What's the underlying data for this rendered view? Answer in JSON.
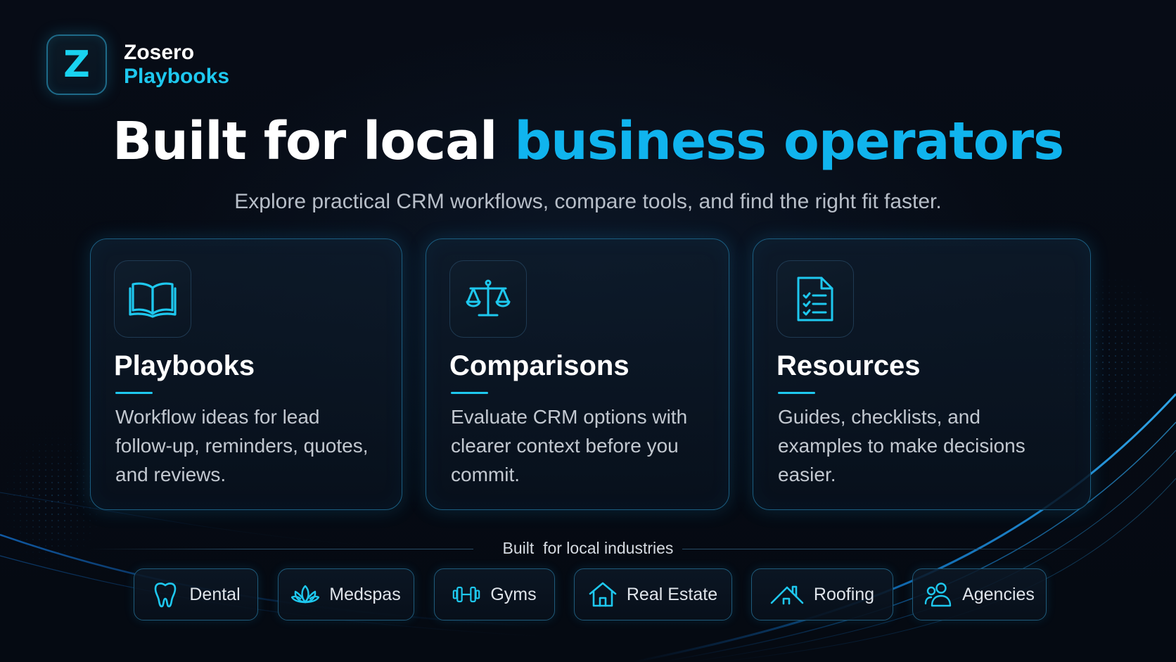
{
  "brand": {
    "badge_letter": "Z",
    "name": "Zosero",
    "product": "Playbooks"
  },
  "hero": {
    "headline_white": "Built for local",
    "headline_accent": "business operators",
    "subheadline": "Explore practical CRM workflows, compare tools, and find the right fit faster."
  },
  "cards": [
    {
      "icon": "open-book-icon",
      "title": "Playbooks",
      "description": "Workflow ideas for lead follow-up, reminders, quotes, and reviews."
    },
    {
      "icon": "balance-scale-icon",
      "title": "Comparisons",
      "description": "Evaluate CRM options with clearer context before you commit."
    },
    {
      "icon": "checklist-document-icon",
      "title": "Resources",
      "description": "Guides, checklists, and examples to make decisions easier."
    }
  ],
  "industries": {
    "label": "Built  for local industries",
    "items": [
      {
        "icon": "tooth-icon",
        "label": "Dental"
      },
      {
        "icon": "lotus-icon",
        "label": "Medspas"
      },
      {
        "icon": "dumbbell-icon",
        "label": "Gyms"
      },
      {
        "icon": "house-icon",
        "label": "Real Estate"
      },
      {
        "icon": "roof-icon",
        "label": "Roofing"
      },
      {
        "icon": "people-icon",
        "label": "Agencies"
      }
    ]
  },
  "colors": {
    "background": "#060b14",
    "accent": "#10b4ee",
    "accent_light": "#1ec8ef",
    "card_border": "#1b5d80",
    "body_text": "#c2c8d0"
  }
}
